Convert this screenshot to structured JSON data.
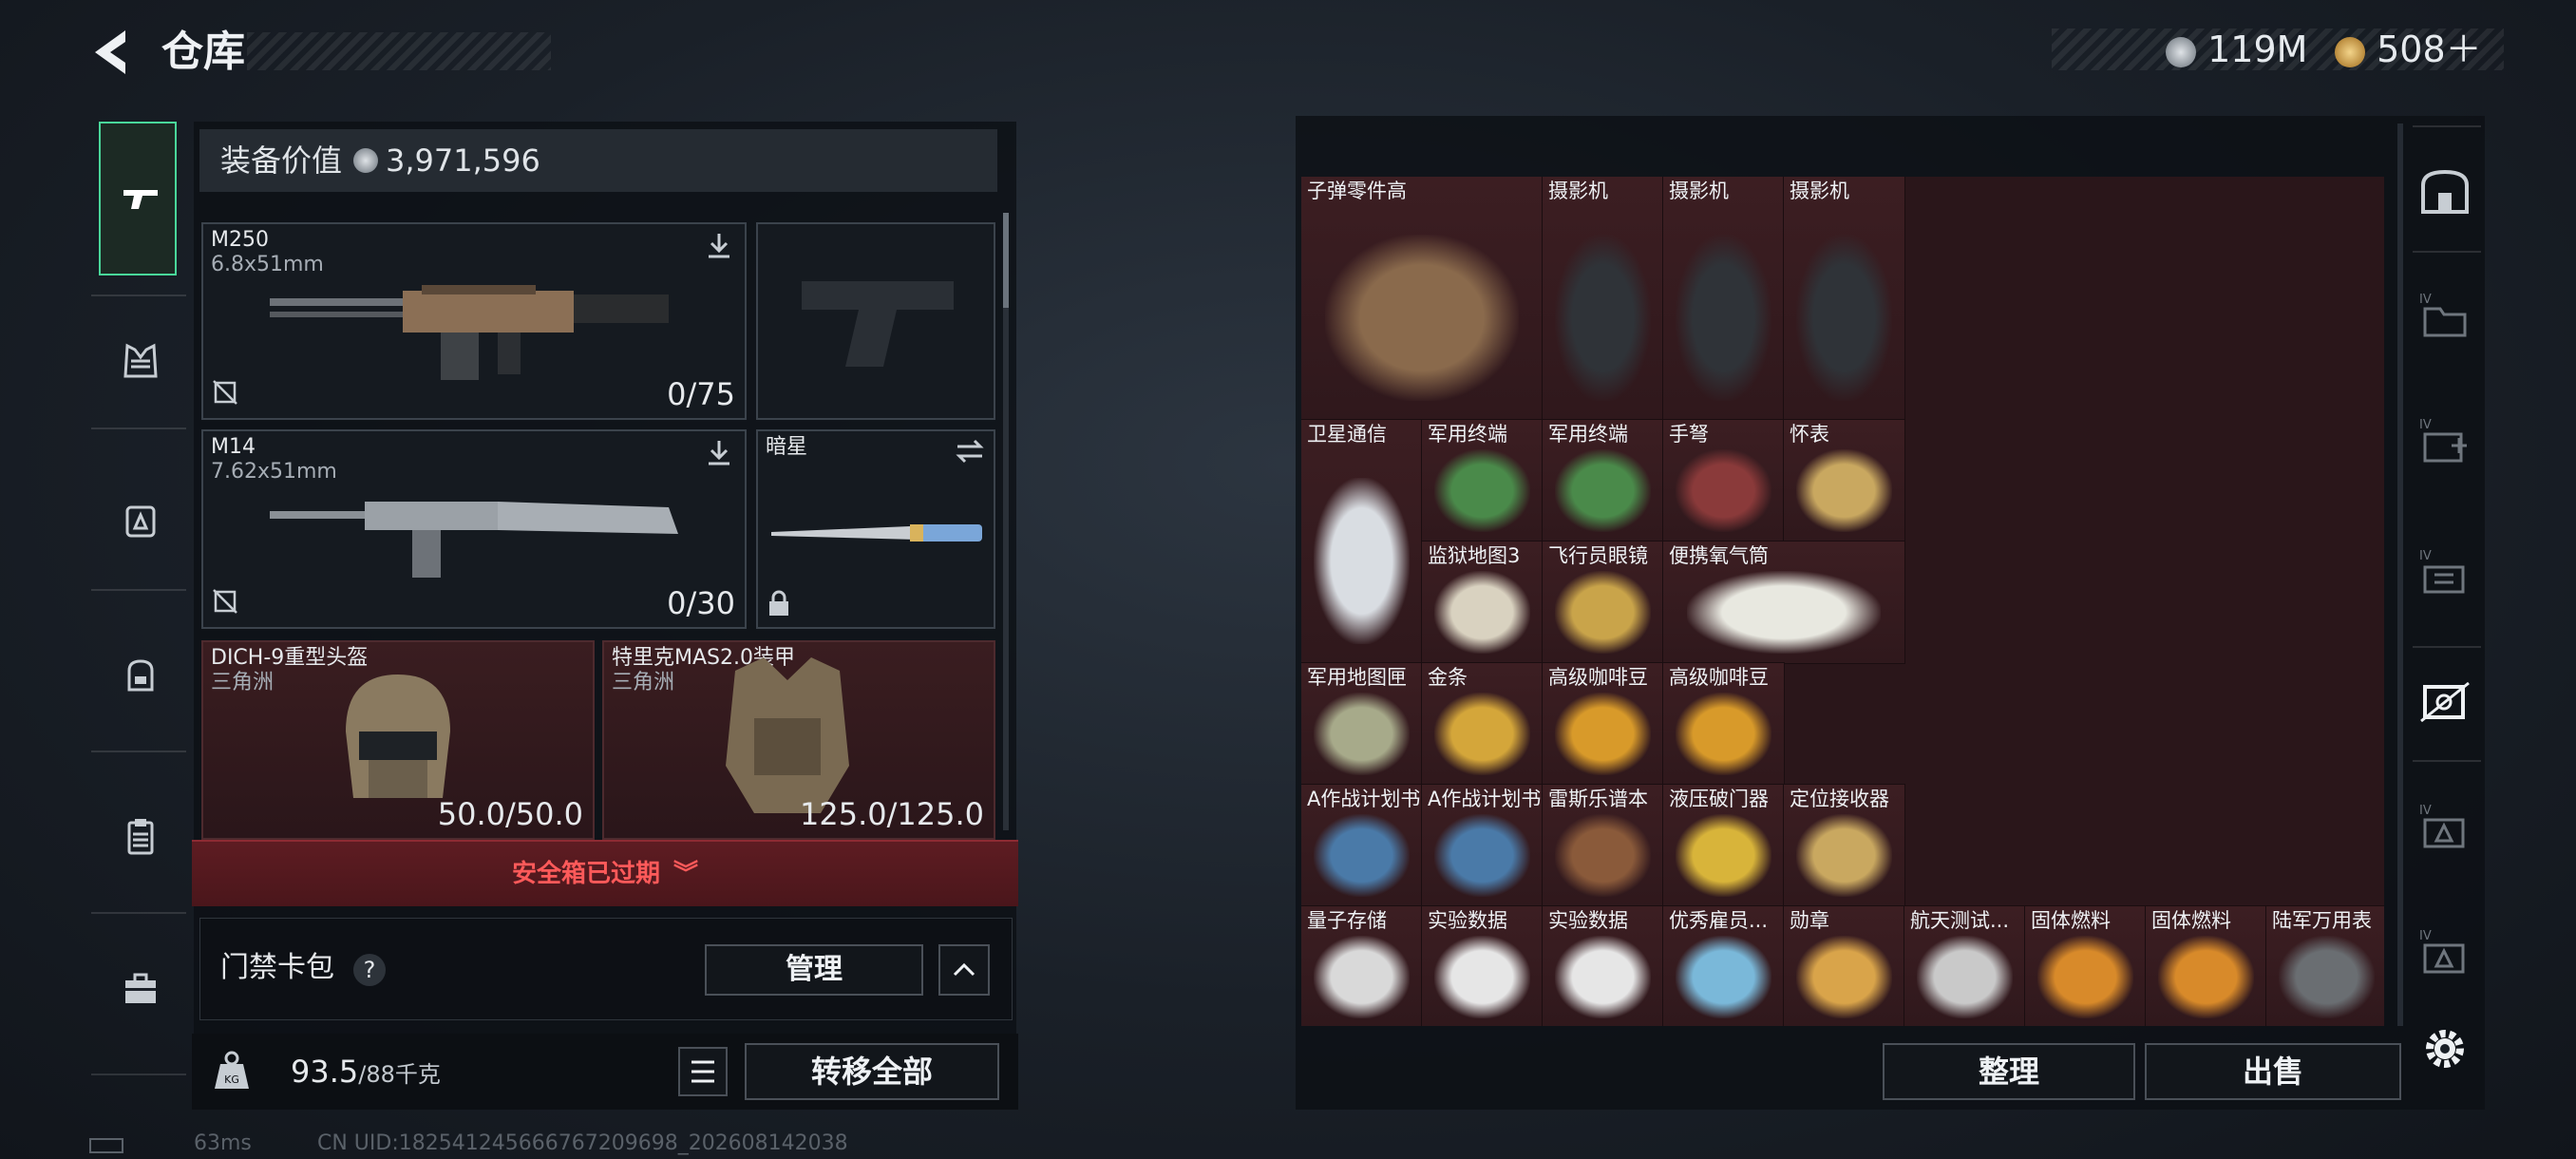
{
  "header": {
    "title": "仓库",
    "currency": [
      {
        "icon": "silver-coin-icon",
        "value": "119M"
      },
      {
        "icon": "gold-coin-icon",
        "value": "508＋"
      }
    ]
  },
  "categories": [
    {
      "name": "weapons-category-icon",
      "selected": true
    },
    {
      "name": "armor-category-icon",
      "selected": false
    },
    {
      "name": "chest-rig-category-icon",
      "selected": false
    },
    {
      "name": "backpack-category-icon",
      "selected": false
    },
    {
      "name": "clipboard-category-icon",
      "selected": false
    },
    {
      "name": "toolbox-category-icon",
      "selected": false
    }
  ],
  "equipment": {
    "label": "装备价值",
    "value": "3,971,596",
    "slots": [
      {
        "id": "m250",
        "name": "M250",
        "sub": "6.8x51mm",
        "count": "0/75"
      },
      {
        "id": "pistol",
        "name": "",
        "sub": "",
        "count": ""
      },
      {
        "id": "m14",
        "name": "M14",
        "sub": "7.62x51mm",
        "count": "0/30"
      },
      {
        "id": "melee",
        "name": "暗星",
        "sub": "",
        "count": ""
      },
      {
        "id": "helmet",
        "name": "DICH-9重型头盔",
        "sub": "三角洲",
        "count": "50.0/50.0"
      },
      {
        "id": "armor",
        "name": "特里克MAS2.0装甲",
        "sub": "三角洲",
        "count": "125.0/125.0"
      }
    ]
  },
  "safebox": {
    "text": "安全箱已过期"
  },
  "keycard": {
    "label": "门禁卡包",
    "help": "?",
    "manage": "管理"
  },
  "weight": {
    "current": "93.5",
    "max": "/88千克"
  },
  "transfer_all": "转移全部",
  "status": {
    "ping": "63ms",
    "uid": "CN UID:1825412456667672096​98_202608142038"
  },
  "stash": {
    "items": [
      {
        "name": "子弹零件高"
      },
      {
        "name": "摄影机"
      },
      {
        "name": "摄影机"
      },
      {
        "name": "摄影机"
      },
      {
        "name": "卫星通信"
      },
      {
        "name": "军用终端"
      },
      {
        "name": "军用终端"
      },
      {
        "name": "手弩"
      },
      {
        "name": "怀表"
      },
      {
        "name": "监狱地图3"
      },
      {
        "name": "飞行员眼镜"
      },
      {
        "name": "便携氧气筒"
      },
      {
        "name": "军用地图匣"
      },
      {
        "name": "金条"
      },
      {
        "name": "高级咖啡豆"
      },
      {
        "name": "高级咖啡豆"
      },
      {
        "name": "A作战计划书"
      },
      {
        "name": "A作战计划书"
      },
      {
        "name": "雷斯乐谱本"
      },
      {
        "name": "液压破门器"
      },
      {
        "name": "定位接收器"
      },
      {
        "name": "量子存储"
      },
      {
        "name": "实验数据"
      },
      {
        "name": "实验数据"
      },
      {
        "name": "优秀雇员..."
      },
      {
        "name": "勋章"
      },
      {
        "name": "航天测试..."
      },
      {
        "name": "固体燃料"
      },
      {
        "name": "固体燃料"
      },
      {
        "name": "陆军万用表"
      }
    ],
    "sort": "整理",
    "sell": "出售"
  },
  "side_tabs": [
    {
      "name": "stash-tab-icon",
      "selected": false
    },
    {
      "name": "folder-iv-icon",
      "selected": false
    },
    {
      "name": "medkit-iv-icon",
      "selected": false
    },
    {
      "name": "ammo-iv-icon",
      "selected": false
    },
    {
      "name": "tools-tab-icon",
      "selected": true
    },
    {
      "name": "triangle-iv-icon",
      "selected": false
    },
    {
      "name": "triangle-iv-2-icon",
      "selected": false
    }
  ],
  "colors": {
    "accent": "#49d79a",
    "danger": "#ff5a5a",
    "slot_red": "#3a1d20"
  }
}
